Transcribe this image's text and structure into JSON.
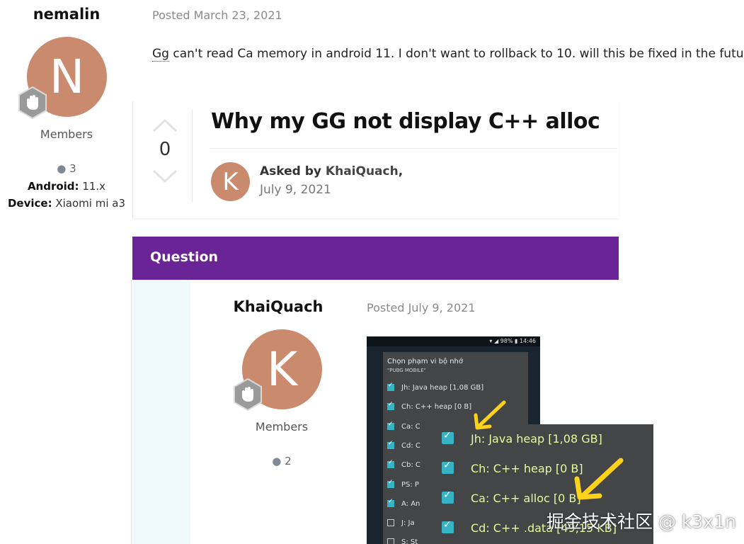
{
  "previous_post": {
    "author": {
      "name": "nemalin",
      "avatar_letter": "N",
      "group": "Members",
      "post_count": "3",
      "fields": [
        {
          "label": "Android:",
          "value": "11.x"
        },
        {
          "label": "Device:",
          "value": "Xiaomi mi a3"
        }
      ]
    },
    "posted": "Posted March 23, 2021",
    "body": {
      "abbr": "Gg",
      "text": " can't read Ca memory in android 11. I don't want to rollback to 10. will this be fixed in the future?"
    }
  },
  "question_card": {
    "votes": "0",
    "title": "Why my GG not display C++ alloc",
    "avatar_letter": "K",
    "asked_prefix": "Asked by",
    "asked_author": "KhaiQuach",
    "asked_suffix": ",",
    "date": "July 9, 2021"
  },
  "question_bar": {
    "label": "Question"
  },
  "question_post": {
    "author": {
      "name": "KhaiQuach",
      "avatar_letter": "K",
      "group": "Members",
      "post_count": "2"
    },
    "posted": "Posted July 9, 2021"
  },
  "screenshot": {
    "status": "▾ ◢ 98% ▮ 14:46",
    "dialog_title": "Chọn phạm vi bộ nhớ",
    "dialog_subtitle": "\"PUBG MOBILE\"",
    "rows": [
      {
        "label": "Jh: Java heap [1,08 GB]",
        "checked": true
      },
      {
        "label": "Ch: C++ heap [0 B]",
        "checked": true
      },
      {
        "label": "Ca: C",
        "checked": true
      },
      {
        "label": "Cd: C",
        "checked": true
      },
      {
        "label": "Cb: C",
        "checked": true
      },
      {
        "label": "PS: P",
        "checked": true
      },
      {
        "label": "A: An",
        "checked": true
      },
      {
        "label": "J: Ja",
        "checked": false
      },
      {
        "label": "S: St",
        "checked": false
      }
    ],
    "zoom_rows": [
      {
        "label": "Jh: Java heap [1,08 GB]"
      },
      {
        "label": "Ch: C++ heap [0 B]"
      },
      {
        "label": "Ca: C++ alloc [0 B]"
      },
      {
        "label": "Cd: C++ .data [49,15 KB]"
      }
    ],
    "arrow_color": "#ffd21a"
  },
  "watermark": "掘金技术社区 @ k3x1n",
  "colors": {
    "accent": "#6a2495",
    "avatar": "#c98a6e",
    "checkbox": "#36b3c4"
  }
}
